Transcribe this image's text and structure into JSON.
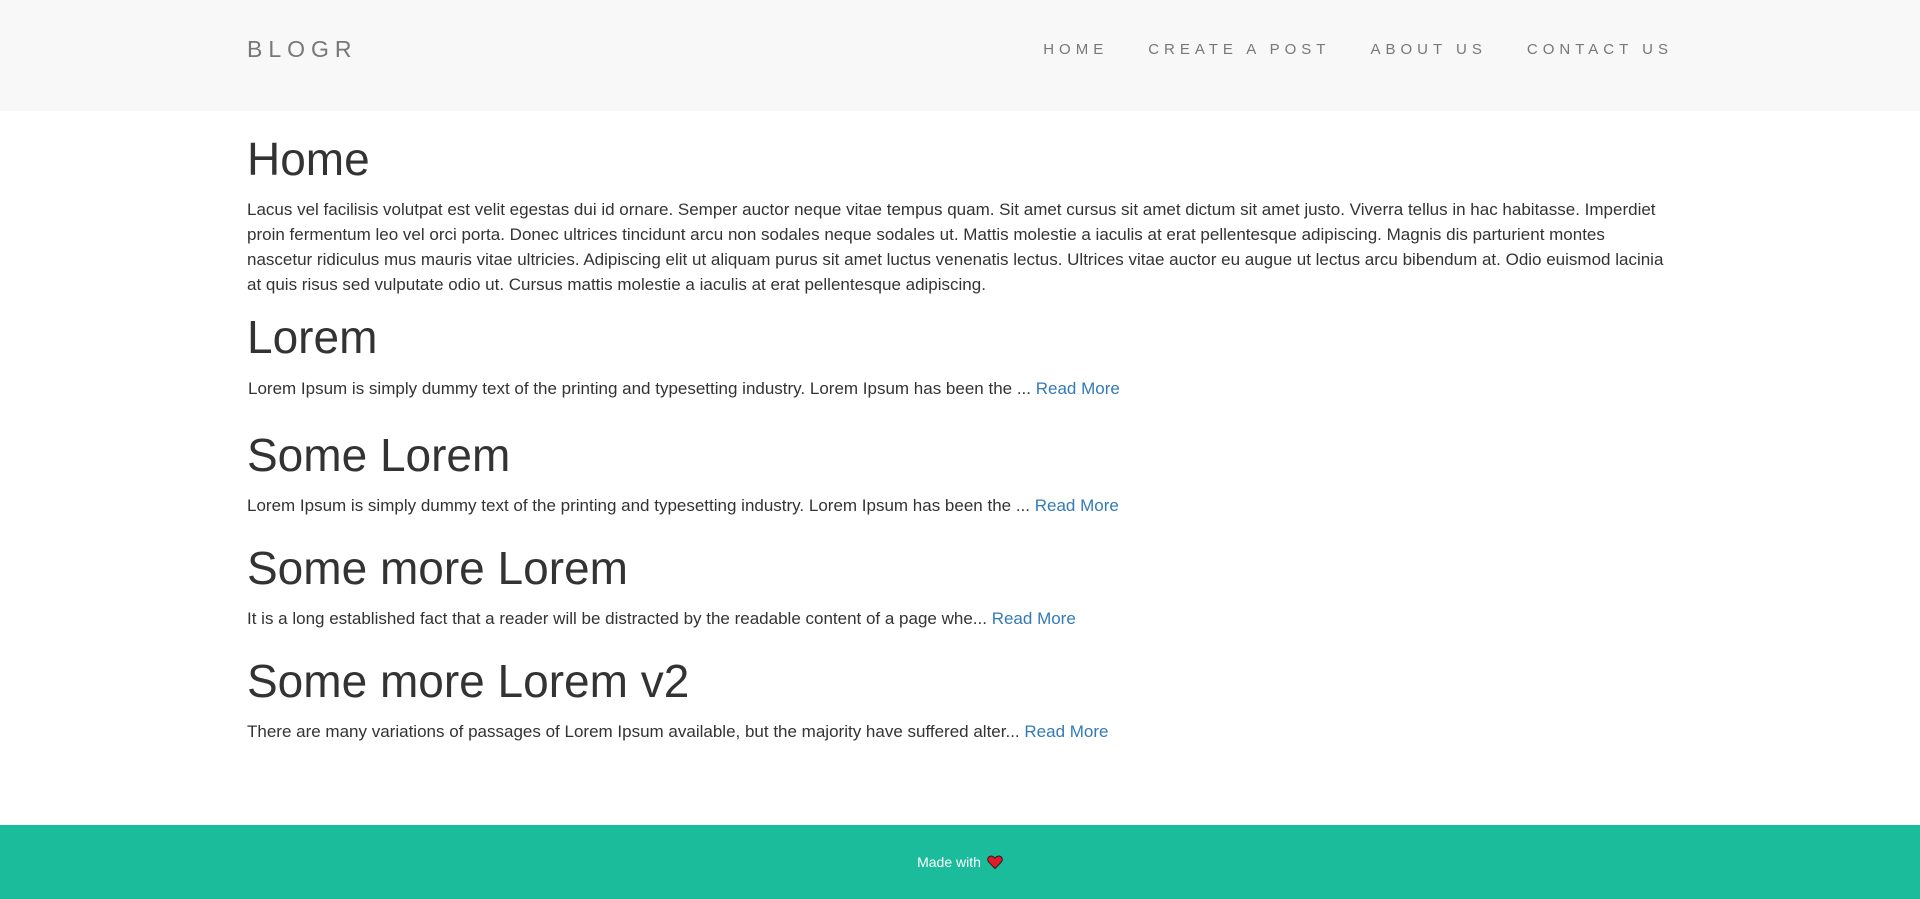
{
  "header": {
    "brand": "BLOGR",
    "nav": [
      "HOME",
      "CREATE A POST",
      "ABOUT US",
      "CONTACT US"
    ]
  },
  "main": {
    "title": "Home",
    "intro": "Lacus vel facilisis volutpat est velit egestas dui id ornare. Semper auctor neque vitae tempus quam. Sit amet cursus sit amet dictum sit amet justo. Viverra tellus in hac habitasse. Imperdiet proin fermentum leo vel orci porta. Donec ultrices tincidunt arcu non sodales neque sodales ut. Mattis molestie a iaculis at erat pellentesque adipiscing. Magnis dis parturient montes nascetur ridiculus mus mauris vitae ultricies. Adipiscing elit ut aliquam purus sit amet luctus venenatis lectus. Ultrices vitae auctor eu augue ut lectus arcu bibendum at. Odio euismod lacinia at quis risus sed vulputate odio ut. Cursus mattis molestie a iaculis at erat pellentesque adipiscing.",
    "posts": [
      {
        "title": "Lorem",
        "excerpt": "Lorem Ipsum is simply dummy text of the printing and typesetting industry. Lorem Ipsum has been the ...",
        "read_more": "Read More"
      },
      {
        "title": "Some Lorem",
        "excerpt": "Lorem Ipsum is simply dummy text of the printing and typesetting industry. Lorem Ipsum has been the ...",
        "read_more": "Read More"
      },
      {
        "title": "Some more Lorem",
        "excerpt": "It is a long established fact that a reader will be distracted by the readable content of a page whe...",
        "read_more": "Read More"
      },
      {
        "title": "Some more Lorem v2",
        "excerpt": "There are many variations of passages of Lorem Ipsum available, but the majority have suffered alter...",
        "read_more": "Read More"
      }
    ]
  },
  "footer": {
    "text": "Made with",
    "icon": "heart-icon",
    "heart_color": "#e21b2c"
  },
  "colors": {
    "navbar_bg": "#f8f8f8",
    "footer_bg": "#1abc9c",
    "link": "#337ab7",
    "text": "#333333",
    "nav_text": "#777777"
  }
}
